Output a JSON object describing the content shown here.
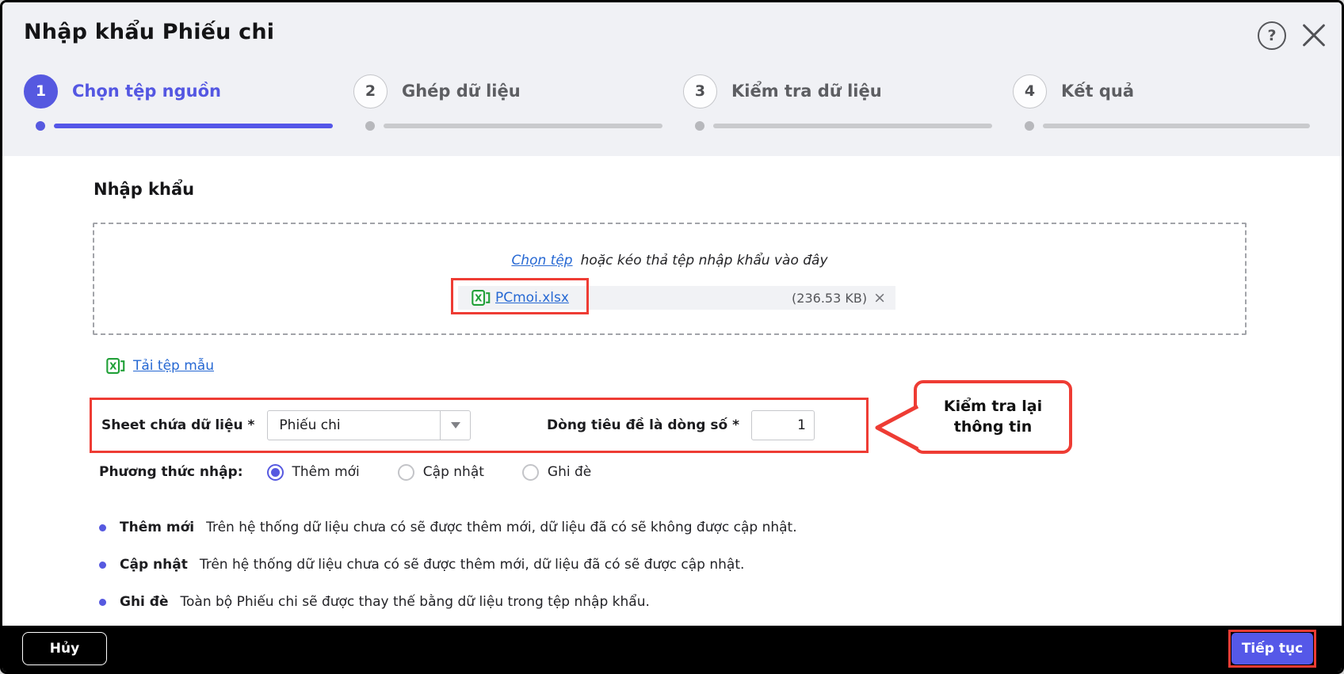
{
  "colors": {
    "accent": "#5659e0",
    "annotation_red": "#ee3c34",
    "link_blue": "#2668d3",
    "excel_green": "#21a038",
    "header_bg": "#f0f1f5",
    "footer_bg": "#000000"
  },
  "header": {
    "title": "Nhập khẩu Phiếu chi",
    "help_icon": "?"
  },
  "steps": [
    {
      "number": "1",
      "label": "Chọn tệp nguồn",
      "active": true
    },
    {
      "number": "2",
      "label": "Ghép dữ liệu",
      "active": false
    },
    {
      "number": "3",
      "label": "Kiểm tra dữ liệu",
      "active": false
    },
    {
      "number": "4",
      "label": "Kết quả",
      "active": false
    }
  ],
  "main": {
    "section_title": "Nhập khẩu",
    "dropzone": {
      "choose_file_link": "Chọn tệp",
      "drag_hint": "hoặc kéo thả tệp nhập khẩu vào đây",
      "file": {
        "name": "PCmoi.xlsx",
        "size": "(236.53 KB)",
        "remove_icon": "×"
      }
    },
    "template_link": "Tải tệp mẫu",
    "form": {
      "sheet_label": "Sheet chứa dữ liệu *",
      "sheet_value": "Phiếu chi",
      "header_row_label": "Dòng tiêu đề là dòng số *",
      "header_row_value": "1"
    },
    "callout": {
      "line1": "Kiểm tra lại",
      "line2": "thông tin"
    },
    "method": {
      "label": "Phương thức nhập:",
      "options": [
        {
          "label": "Thêm mới",
          "selected": true
        },
        {
          "label": "Cập nhật",
          "selected": false
        },
        {
          "label": "Ghi đè",
          "selected": false
        }
      ]
    },
    "notes": [
      {
        "term": "Thêm mới",
        "desc": "Trên hệ thống dữ liệu chưa có sẽ được thêm mới, dữ liệu đã có sẽ không được cập nhật."
      },
      {
        "term": "Cập nhật",
        "desc": "Trên hệ thống dữ liệu chưa có sẽ được thêm mới, dữ liệu đã có sẽ được cập nhật."
      },
      {
        "term": "Ghi đè",
        "desc": "Toàn bộ Phiếu chi sẽ được thay thế bằng dữ liệu trong tệp nhập khẩu."
      }
    ]
  },
  "footer": {
    "cancel_label": "Hủy",
    "continue_label": "Tiếp tục"
  }
}
